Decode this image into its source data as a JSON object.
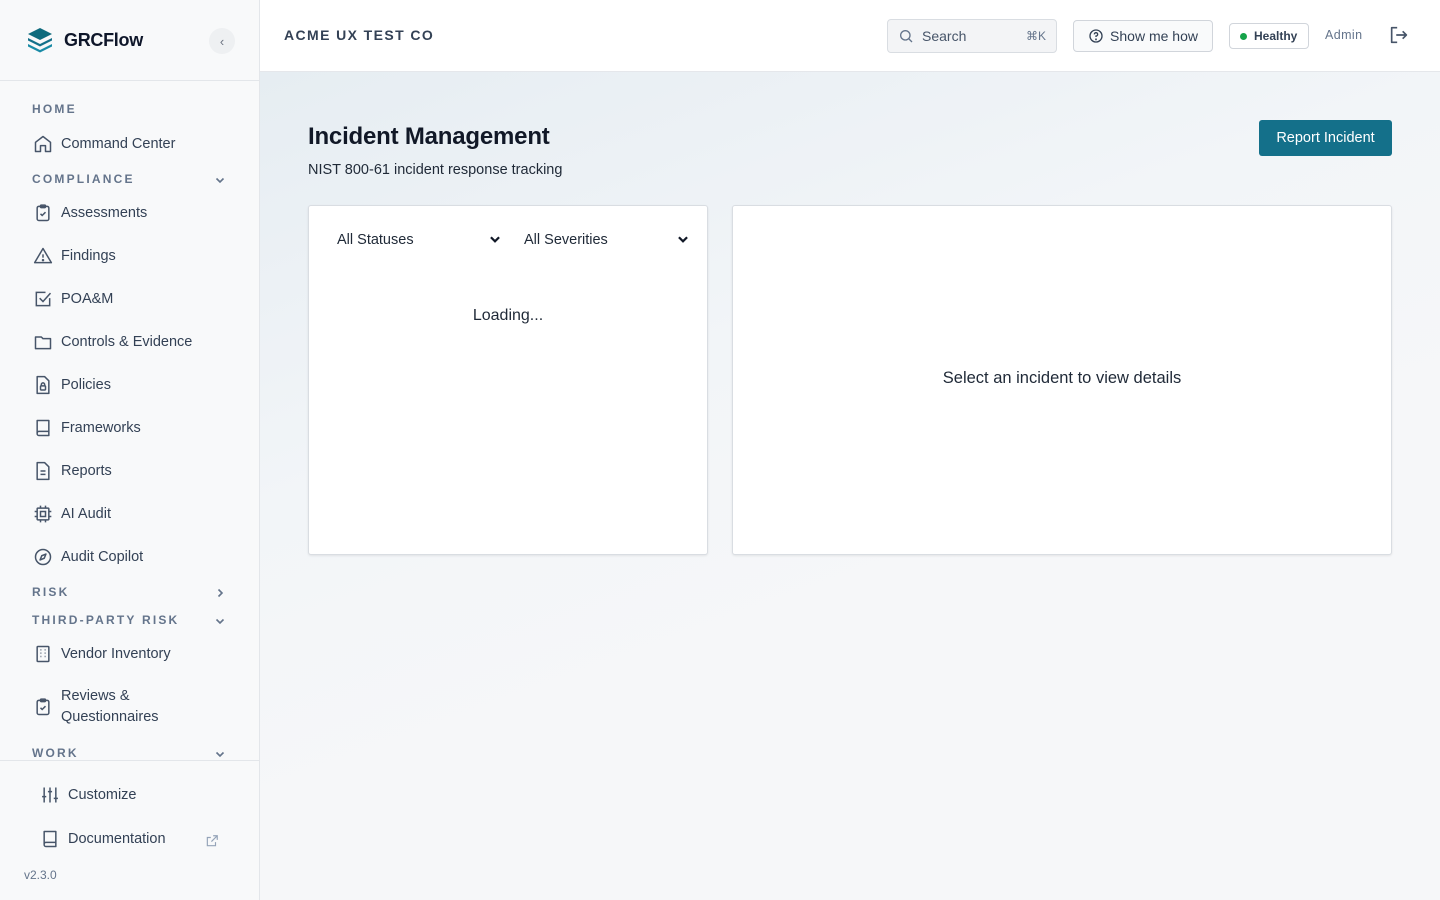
{
  "brand": {
    "name": "GRCFlow",
    "collapse_glyph": "‹"
  },
  "sidebar": {
    "sections": [
      {
        "label": "HOME"
      },
      {
        "label": "COMPLIANCE"
      },
      {
        "label": "RISK"
      },
      {
        "label": "THIRD-PARTY RISK"
      },
      {
        "label": "WORK"
      }
    ],
    "items": [
      {
        "label": "Command Center",
        "icon": "home-icon"
      },
      {
        "label": "Assessments",
        "icon": "clipboard-check-icon"
      },
      {
        "label": "Findings",
        "icon": "warning-triangle-icon"
      },
      {
        "label": "POA&M",
        "icon": "checkbox-icon"
      },
      {
        "label": "Controls & Evidence",
        "icon": "folder-icon"
      },
      {
        "label": "Policies",
        "icon": "file-lock-icon"
      },
      {
        "label": "Frameworks",
        "icon": "book-icon"
      },
      {
        "label": "Reports",
        "icon": "file-text-icon"
      },
      {
        "label": "AI Audit",
        "icon": "cpu-icon"
      },
      {
        "label": "Audit Copilot",
        "icon": "compass-icon"
      },
      {
        "label": "Vendor Inventory",
        "icon": "building-icon"
      },
      {
        "label": "Reviews & Questionnaires",
        "icon": "clipboard-check-icon"
      }
    ],
    "bottom": {
      "customize": "Customize",
      "documentation": "Documentation",
      "version": "v2.3.0"
    }
  },
  "topbar": {
    "org": "ACME UX TEST CO",
    "search_label": "Search",
    "search_shortcut": "⌘K",
    "help_label": "Show me how",
    "status_label": "Healthy",
    "status_color": "#16a34a",
    "user": "Admin"
  },
  "page": {
    "title": "Incident Management",
    "subtitle": "NIST 800-61 incident response tracking",
    "primary_action": "Report Incident",
    "accent": "#14708a"
  },
  "filters": {
    "status": "All Statuses",
    "severity": "All Severities"
  },
  "list": {
    "loading": "Loading..."
  },
  "detail": {
    "empty": "Select an incident to view details"
  }
}
